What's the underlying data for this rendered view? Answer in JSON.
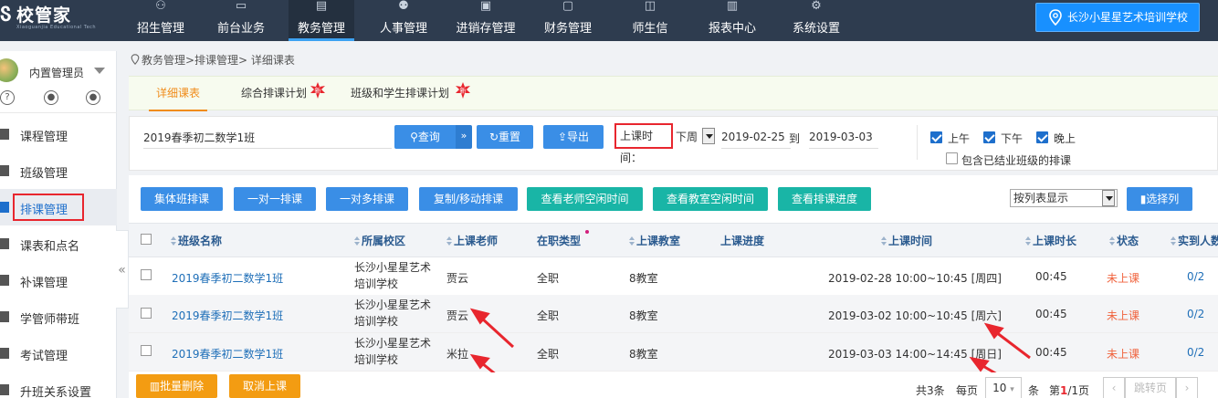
{
  "app": {
    "logo_text": "校管家",
    "logo_sub": "Xiaoguanjia Educational Tech"
  },
  "nav": {
    "items": [
      "招生管理",
      "前台业务",
      "教务管理",
      "人事管理",
      "进销存管理",
      "财务管理",
      "师生信",
      "报表中心",
      "系统设置"
    ],
    "active": "教务管理",
    "school": "长沙小星星艺术培训学校"
  },
  "sidebar": {
    "user": "内置管理员",
    "user_icons": [
      "?",
      "●",
      "●"
    ],
    "items": [
      "课程管理",
      "班级管理",
      "排课管理",
      "课表和点名",
      "补课管理",
      "学管师带班",
      "考试管理",
      "升班关系设置"
    ],
    "active": "排课管理",
    "collapse": "«"
  },
  "breadcrumb": "教务管理>排课管理> 详细课表",
  "tabs": {
    "items": [
      "详细课表",
      "综合排课计划",
      "班级和学生排课计划"
    ],
    "new_badge": "新"
  },
  "filter": {
    "search_value": "2019春季初二数学1班",
    "query_button": "查询",
    "reset_button": "重置",
    "export_button": "导出",
    "time_label": "上课时间：",
    "week_select": "下周",
    "date_from": "2019-02-25",
    "to_label": "到",
    "date_to": "2019-03-03",
    "morning": "上午",
    "afternoon": "下午",
    "evening": "晚上",
    "include_finished": "包含已结业班级的排课"
  },
  "actions": {
    "buttons": [
      "集体班排课",
      "一对一排课",
      "一对多排课",
      "复制/移动排课"
    ],
    "teal_buttons": [
      "查看老师空闲时间",
      "查看教室空闲时间",
      "查看排课进度"
    ],
    "view_select": "按列表显示",
    "select_columns": "选择列"
  },
  "table": {
    "headers": [
      "班级名称",
      "所属校区",
      "上课老师",
      "在职类型",
      "上课教室",
      "上课进度",
      "上课时间",
      "上课时长",
      "状态",
      "实到人数"
    ],
    "rows": [
      {
        "class_name": "2019春季初二数学1班",
        "campus_line1": "长沙小星星艺术",
        "campus_line2": "培训学校",
        "teacher": "贾云",
        "emp_type": "全职",
        "room": "8教室",
        "progress": "",
        "time": "2019-02-28 10:00~10:45 [周四]",
        "duration": "00:45",
        "status": "未上课",
        "attendance": "0/2"
      },
      {
        "class_name": "2019春季初二数学1班",
        "campus_line1": "长沙小星星艺术",
        "campus_line2": "培训学校",
        "teacher": "贾云",
        "emp_type": "全职",
        "room": "8教室",
        "progress": "",
        "time": "2019-03-02 10:00~10:45 [周六]",
        "duration": "00:45",
        "status": "未上课",
        "attendance": "0/2"
      },
      {
        "class_name": "2019春季初二数学1班",
        "campus_line1": "长沙小星星艺术",
        "campus_line2": "培训学校",
        "teacher": "米拉",
        "emp_type": "全职",
        "room": "8教室",
        "progress": "",
        "time": "2019-03-03 14:00~14:45 [周日]",
        "duration": "00:45",
        "status": "未上课",
        "attendance": "0/2"
      }
    ]
  },
  "footer": {
    "batch_delete": "批量删除",
    "cancel_class": "取消上课",
    "total_prefix": "共3条",
    "per_page_label": "每页",
    "per_page": "10",
    "unit": "条",
    "page_prefix": "第",
    "page_current": "1",
    "page_suffix": "/1页",
    "jump": "跳转页"
  },
  "colors": {
    "nav_bg": "#2e3c4f",
    "accent_blue": "#3a8ee6",
    "teal": "#19b5a6",
    "orange": "#f39c12",
    "annotation_red": "#e8262e"
  }
}
